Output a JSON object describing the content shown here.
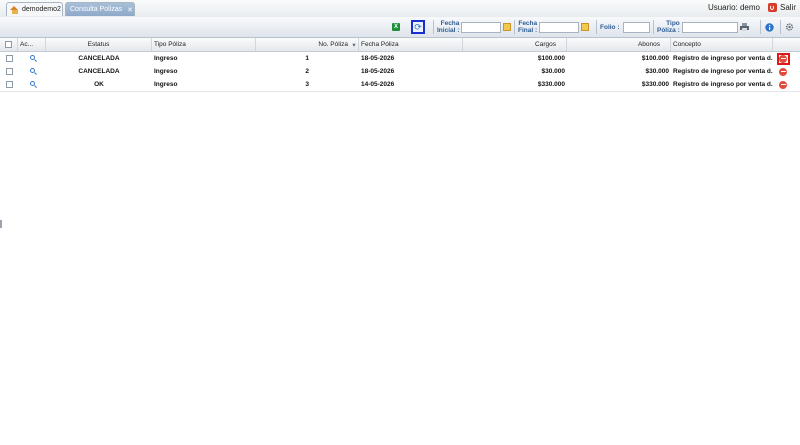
{
  "tabs": {
    "home_label": "demodemo2",
    "active_label": "Consulta Polizas",
    "close_glyph": "✕"
  },
  "user": {
    "label": "Usuario: demo",
    "exit_label": "Salir"
  },
  "filters": {
    "fecha_inicial_label_1": "Fecha",
    "fecha_inicial_label_2": "Inicial :",
    "fecha_final_label_1": "Fecha",
    "fecha_final_label_2": "Final :",
    "folio_label": "Folio :",
    "tipo_poliza_label_1": "Tipo",
    "tipo_poliza_label_2": "Póliza :",
    "fecha_inicial_value": "",
    "fecha_final_value": "",
    "folio_value": "",
    "tipo_poliza_value": ""
  },
  "icons": {
    "excel": "excel-icon",
    "refresh": "refresh-icon",
    "calendar": "calendar-icon",
    "print": "print-icon",
    "info": "info-icon",
    "settings": "gear-icon",
    "view": "magnifier-icon",
    "delete": "delete-icon"
  },
  "colors": {
    "active_tab": "#8ea9c8",
    "label_blue": "#2b5c93",
    "delete_red": "#e34b3c",
    "highlight_blue": "#1830d0",
    "highlight_red": "#e01818"
  },
  "grid": {
    "columns": [
      "Ac...",
      "Estatus",
      "Tipo Póliza",
      "No. Póliza",
      "Fecha Póliza",
      "Cargos",
      "Abonos",
      "Concepto"
    ],
    "sort_indicator": "▾",
    "rows": [
      {
        "estatus": "CANCELADA",
        "tipo": "Ingreso",
        "no": "1",
        "fecha": "18-05-2026",
        "cargos": "$100.000",
        "abonos": "$100.000",
        "concepto": "Registro de ingreso por venta d..."
      },
      {
        "estatus": "CANCELADA",
        "tipo": "Ingreso",
        "no": "2",
        "fecha": "18-05-2026",
        "cargos": "$30.000",
        "abonos": "$30.000",
        "concepto": "Registro de ingreso por venta d..."
      },
      {
        "estatus": "OK",
        "tipo": "Ingreso",
        "no": "3",
        "fecha": "14-05-2026",
        "cargos": "$330.000",
        "abonos": "$330.000",
        "concepto": "Registro de ingreso por venta d..."
      }
    ]
  }
}
